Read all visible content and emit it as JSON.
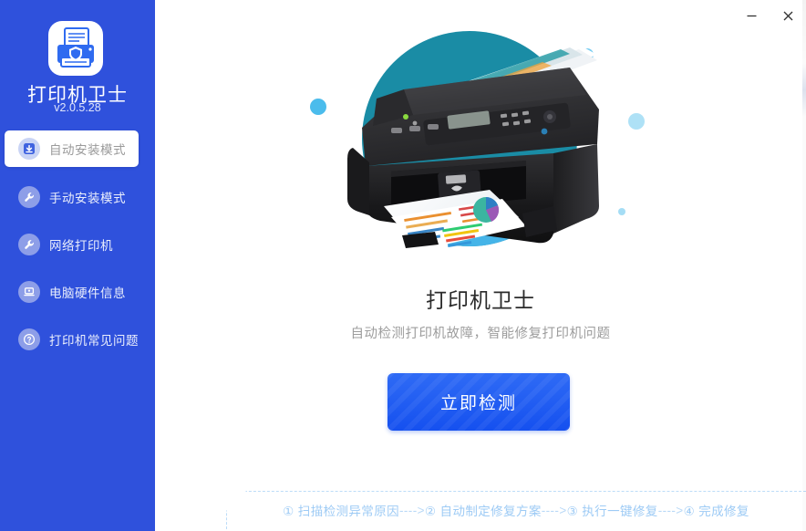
{
  "sidebar": {
    "brand_title": "打印机卫士",
    "version": "v2.0.5.28",
    "logo_icon": "printer-shield-icon",
    "accent_color": "#2f51dc",
    "items": [
      {
        "label": "自动安装模式",
        "icon": "download-box-icon",
        "active": true
      },
      {
        "label": "手动安装模式",
        "icon": "wrench-icon",
        "active": false
      },
      {
        "label": "网络打印机",
        "icon": "wrench-icon",
        "active": false
      },
      {
        "label": "电脑硬件信息",
        "icon": "monitor-icon",
        "active": false
      },
      {
        "label": "打印机常见问题",
        "icon": "question-icon",
        "active": false
      }
    ]
  },
  "titlebar": {
    "minimize_label": "—",
    "close_label": "✕"
  },
  "hero": {
    "illustration": "printer-illustration",
    "circle_color": "#1a8ca5",
    "arc_color": "#45b4e8",
    "dot_color": "#4bbcec"
  },
  "main": {
    "headline": "打印机卫士",
    "subhead": "自动检测打印机故障，智能修复打印机问题",
    "cta_label": "立即检测",
    "cta_color": "#1b5ef0"
  },
  "steps": {
    "separator": "---->",
    "items": [
      "① 扫描检测异常原因",
      "② 自动制定修复方案",
      "③ 执行一键修复",
      "④ 完成修复"
    ],
    "text_color": "#9ecbf5"
  }
}
